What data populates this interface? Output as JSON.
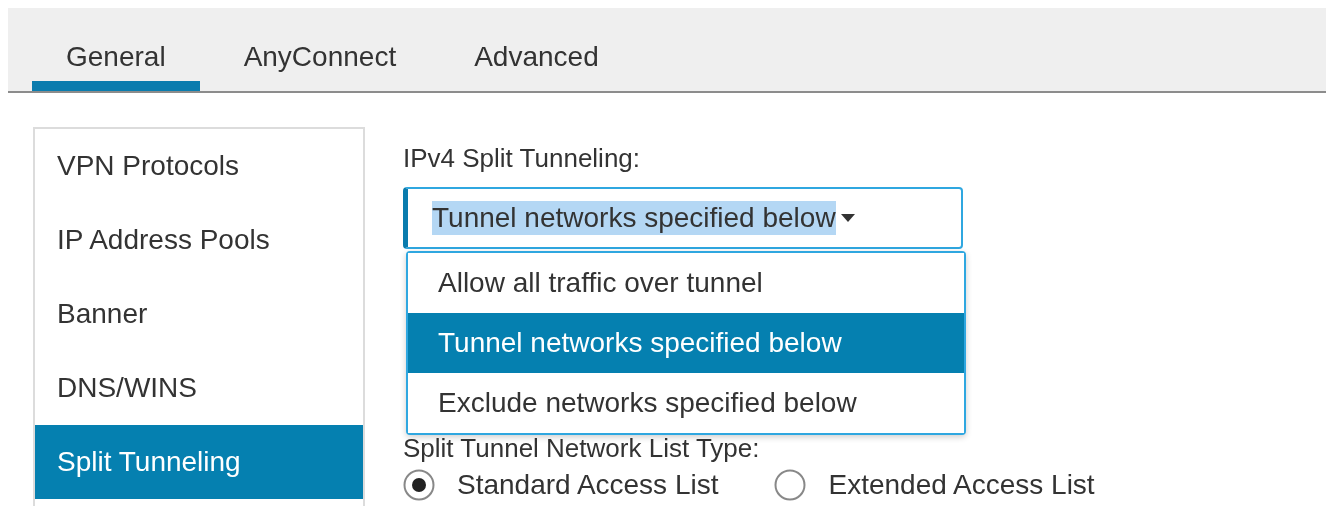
{
  "tabs": [
    {
      "label": "General",
      "selected": true
    },
    {
      "label": "AnyConnect",
      "selected": false
    },
    {
      "label": "Advanced",
      "selected": false
    }
  ],
  "sidebar": {
    "items": [
      {
        "label": "VPN Protocols",
        "selected": false
      },
      {
        "label": "IP Address Pools",
        "selected": false
      },
      {
        "label": "Banner",
        "selected": false
      },
      {
        "label": "DNS/WINS",
        "selected": false
      },
      {
        "label": "Split Tunneling",
        "selected": true
      }
    ]
  },
  "ipv4_split_tunneling": {
    "label": "IPv4 Split Tunneling:",
    "value": "Tunnel networks specified below",
    "options": [
      {
        "label": "Allow all traffic over tunnel",
        "selected": false
      },
      {
        "label": "Tunnel networks specified below",
        "selected": true
      },
      {
        "label": "Exclude networks specified below",
        "selected": false
      }
    ]
  },
  "list_type": {
    "label": "Split Tunnel Network List Type:",
    "options": [
      {
        "label": "Standard Access List",
        "selected": true
      },
      {
        "label": "Extended Access List",
        "selected": false
      }
    ]
  }
}
